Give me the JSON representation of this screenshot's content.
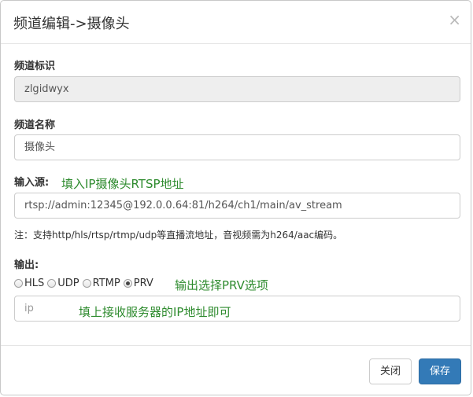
{
  "modal": {
    "title": "频道编辑->摄像头",
    "close_glyph": "×"
  },
  "fields": {
    "channel_id": {
      "label": "频道标识",
      "value": "zlgidwyx"
    },
    "channel_name": {
      "label": "频道名称",
      "value": "摄像头"
    },
    "input_source": {
      "label": "输入源:",
      "value": "rtsp://admin:12345@192.0.0.64:81/h264/ch1/main/av_stream",
      "annotation": "填入IP摄像头RTSP地址"
    },
    "note": "注：支持http/hls/rtsp/rtmp/udp等直播流地址，音视频需为h264/aac编码。",
    "output": {
      "label": "输出:",
      "options": [
        {
          "label": "HLS",
          "checked": false
        },
        {
          "label": "UDP",
          "checked": false
        },
        {
          "label": "RTMP",
          "checked": false
        },
        {
          "label": "PRV",
          "checked": true
        }
      ],
      "annotation": "输出选择PRV选项",
      "ip_placeholder": "ip",
      "ip_annotation": "填上接收服务器的IP地址即可"
    }
  },
  "footer": {
    "close_label": "关闭",
    "save_label": "保存"
  },
  "colors": {
    "annotation": "#2e8b2e",
    "primary": "#337ab7"
  }
}
